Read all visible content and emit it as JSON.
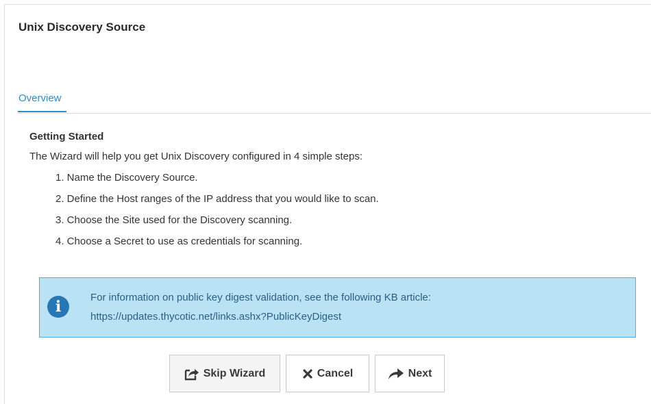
{
  "page": {
    "title": "Unix Discovery Source"
  },
  "tabs": [
    {
      "label": "Overview",
      "active": true
    }
  ],
  "overview": {
    "section_title": "Getting Started",
    "intro": "The Wizard will help you get Unix Discovery configured in 4 simple steps:",
    "steps": [
      "1. Name the Discovery Source.",
      "2. Define the Host ranges of the IP address that you would like to scan.",
      "3. Choose the Site used for the Discovery scanning.",
      "4. Choose a Secret to use as credentials for scanning."
    ]
  },
  "alert": {
    "icon": "info-icon",
    "line1": "For information on public key digest validation, see the following KB article:",
    "line2": "https://updates.thycotic.net/links.ashx?PublicKeyDigest"
  },
  "buttons": {
    "skip_label": "Skip Wizard",
    "cancel_label": "Cancel",
    "next_label": "Next"
  },
  "colors": {
    "accent": "#2e8bc9",
    "alert_bg": "#b9e2f5",
    "alert_border": "#5aa9d6",
    "info_icon": "#2776b5"
  }
}
